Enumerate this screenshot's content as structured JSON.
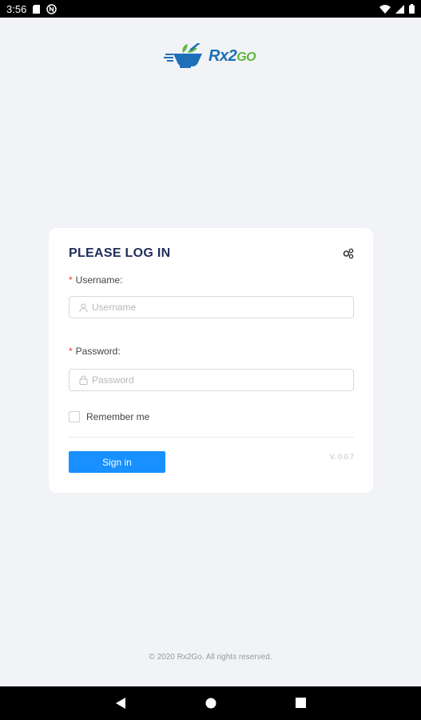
{
  "status_bar": {
    "time": "3:56",
    "icons": [
      "sd-card-icon",
      "n-notification-icon",
      "wifi-icon",
      "signal-icon",
      "battery-icon"
    ]
  },
  "app": {
    "logo_text_main": "Rx",
    "logo_text_num": "2",
    "logo_text_suffix": "GO"
  },
  "login": {
    "title": "PLEASE LOG IN",
    "username_label": "Username",
    "username_placeholder": "Username",
    "password_label": "Password",
    "password_placeholder": "Password",
    "remember_label": "Remember me",
    "signin_label": "Sign in",
    "version": "V. 0.0.7"
  },
  "footer": {
    "copyright": "© 2020 Rx2Go. All rights reserved."
  },
  "colors": {
    "primary": "#1890ff",
    "brand_blue": "#1d6fb8",
    "brand_green": "#5cb63a",
    "background": "#f1f3f6"
  }
}
